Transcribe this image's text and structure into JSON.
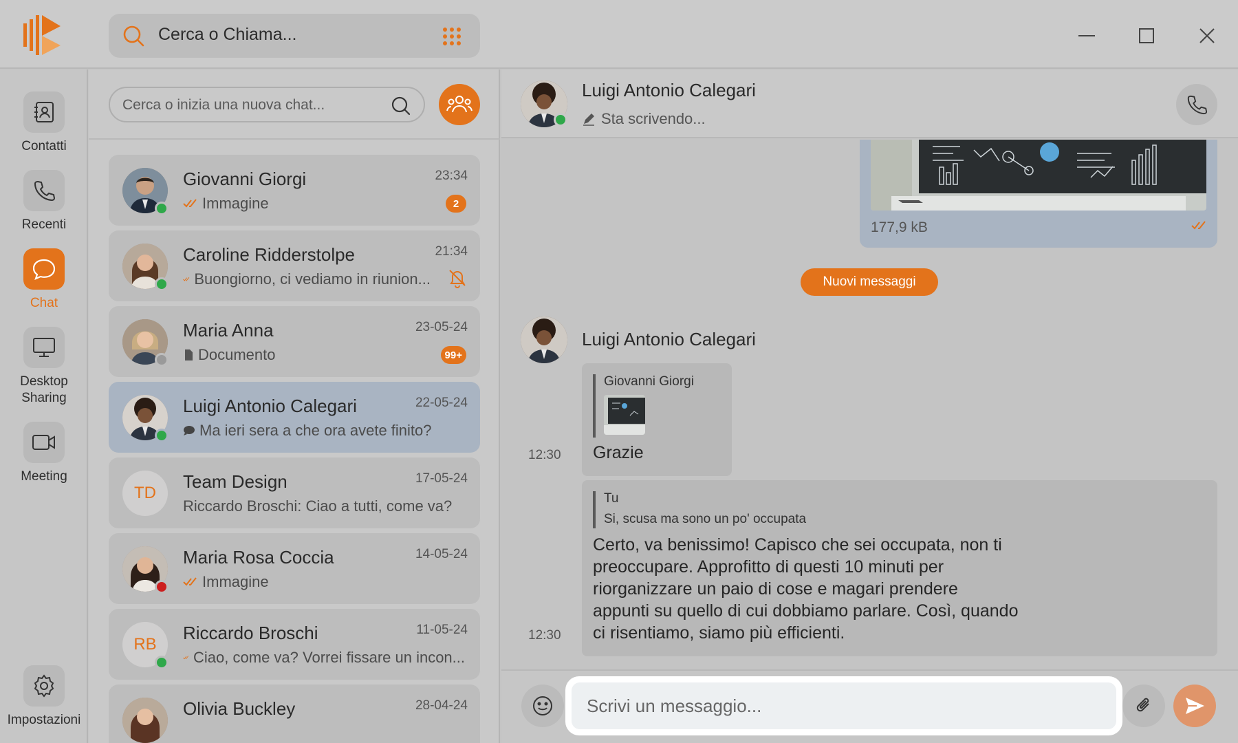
{
  "topbar": {
    "search_label": "Cerca o Chiama..."
  },
  "rail": {
    "items": [
      {
        "label": "Contatti",
        "icon": "contacts-book-icon"
      },
      {
        "label": "Recenti",
        "icon": "phone-icon"
      },
      {
        "label": "Chat",
        "icon": "chat-bubble-icon",
        "active": true
      },
      {
        "label": "Desktop Sharing",
        "icon": "monitor-icon"
      },
      {
        "label": "Meeting",
        "icon": "video-camera-icon"
      }
    ],
    "settings_label": "Impostazioni"
  },
  "chatlist": {
    "search_placeholder": "Cerca o inizia una nuova chat...",
    "items": [
      {
        "name": "Giovanni Giorgi",
        "time": "23:34",
        "preview": "Immagine",
        "badge": "2",
        "status": "online"
      },
      {
        "name": "Caroline Ridderstolpe",
        "time": "21:34",
        "preview": "Buongiorno, ci vediamo in riunion...",
        "muted": true,
        "status": "online"
      },
      {
        "name": "Maria Anna",
        "time": "23-05-24",
        "preview": "Documento",
        "badge": "99+",
        "status": "away"
      },
      {
        "name": "Luigi Antonio Calegari",
        "time": "22-05-24",
        "preview": "Ma ieri sera a che ora avete finito?",
        "status": "online",
        "selected": true
      },
      {
        "name": "Team Design",
        "time": "17-05-24",
        "preview": "Riccardo Broschi: Ciao a tutti, come va?",
        "initials": "TD"
      },
      {
        "name": "Maria Rosa Coccia",
        "time": "14-05-24",
        "preview": "Immagine",
        "status": "busy"
      },
      {
        "name": "Riccardo Broschi",
        "time": "11-05-24",
        "preview": "Ciao, come va? Vorrei fissare un incon...",
        "initials": "RB",
        "status": "online"
      },
      {
        "name": "Olivia Buckley",
        "time": "28-04-24"
      }
    ]
  },
  "conversation": {
    "contact_name": "Luigi Antonio Calegari",
    "typing_status": "Sta scrivendo...",
    "image_size": "177,9 kB",
    "new_messages_label": "Nuovi messaggi",
    "sender_name": "Luigi Antonio Calegari",
    "messages": [
      {
        "quote_name": "Giovanni Giorgi",
        "text": "Grazie",
        "time": "12:30"
      },
      {
        "quote_name": "Tu",
        "quote_text": "Si, scusa ma sono un po' occupata",
        "text_lines": [
          "Certo, va benissimo! Capisco che sei occupata, non ti",
          "preoccupare. Approfitto di questi 10 minuti per",
          "riorganizzare un paio di cose e magari prendere",
          "appunti su quello di cui dobbiamo parlare. Così, quando",
          "ci risentiamo, siamo più efficienti."
        ],
        "time": "12:30"
      }
    ]
  },
  "composer": {
    "placeholder": "Scrivi un messaggio..."
  },
  "colors": {
    "accent": "#e3731b",
    "online": "#2fa84a",
    "busy": "#cc1e1e",
    "selected": "#a9b4c2"
  }
}
